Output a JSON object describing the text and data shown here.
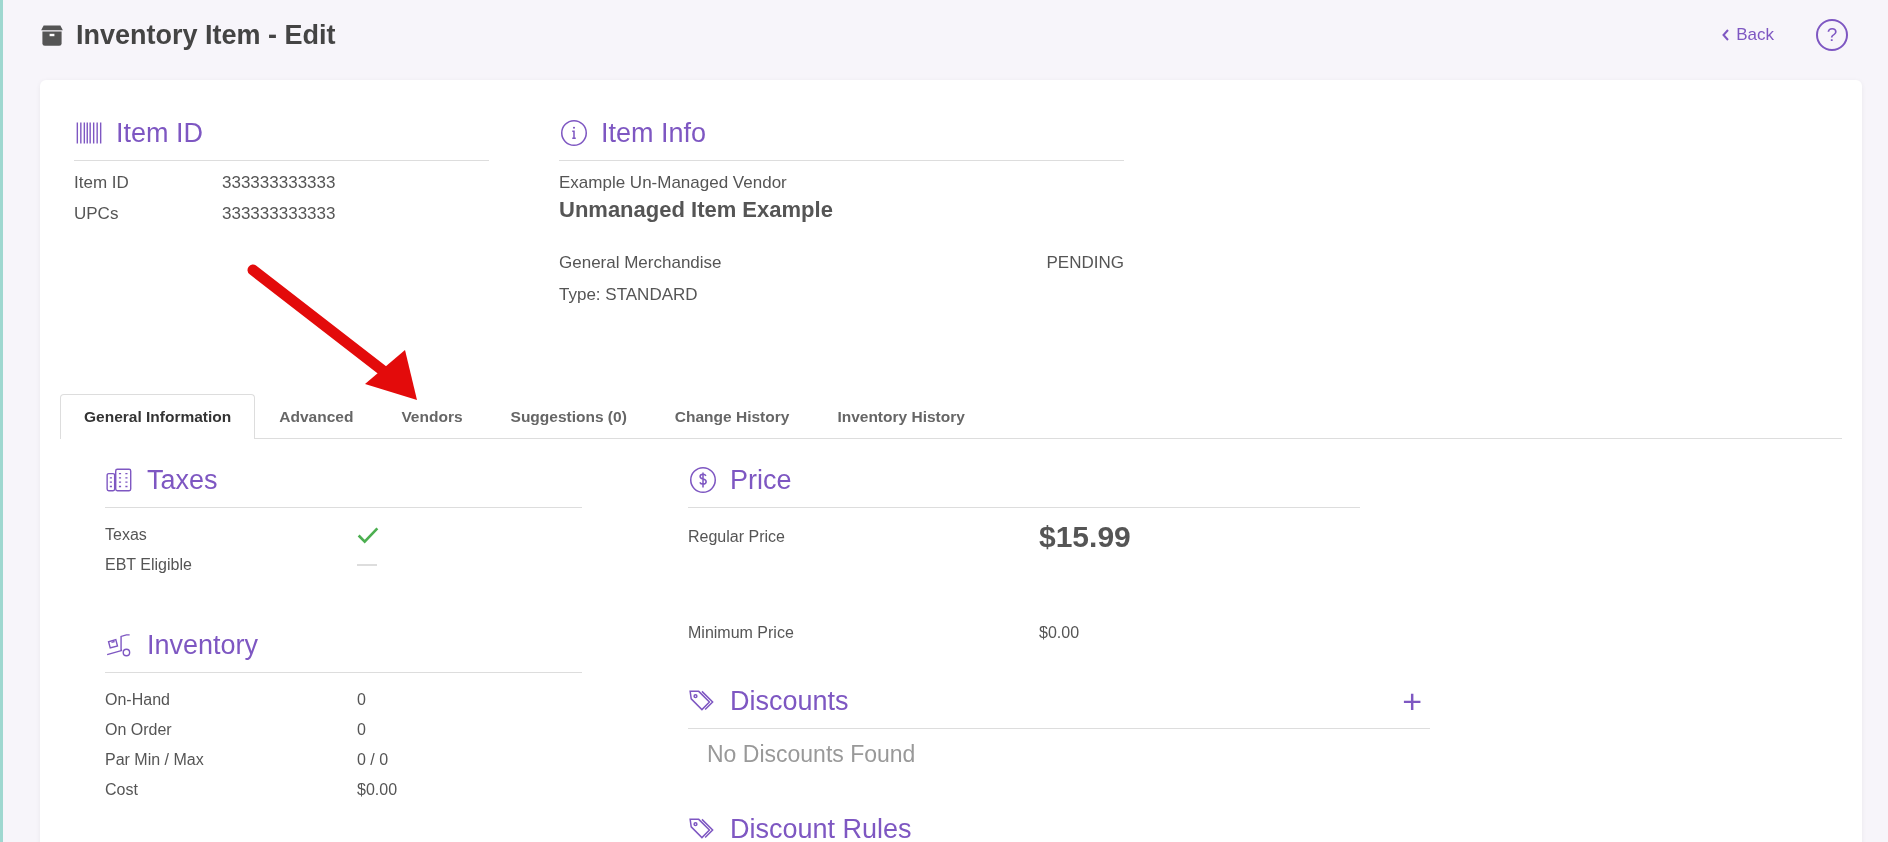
{
  "page": {
    "title": "Inventory Item - Edit",
    "back_link": "Back",
    "help_button": "?"
  },
  "item_id": {
    "heading": "Item ID",
    "rows": [
      {
        "label": "Item ID",
        "value": "333333333333"
      },
      {
        "label": "UPCs",
        "value": "333333333333"
      }
    ]
  },
  "item_info": {
    "heading": "Item Info",
    "vendor": "Example Un-Managed Vendor",
    "name": "Unmanaged Item Example",
    "category": "General Merchandise",
    "status": "PENDING",
    "type": "Type: STANDARD"
  },
  "tabs": [
    {
      "label": "General Information",
      "selected": true
    },
    {
      "label": "Advanced",
      "selected": false
    },
    {
      "label": "Vendors",
      "selected": false
    },
    {
      "label": "Suggestions (0)",
      "selected": false
    },
    {
      "label": "Change History",
      "selected": false
    },
    {
      "label": "Inventory History",
      "selected": false
    }
  ],
  "taxes": {
    "heading": "Taxes",
    "rows": [
      {
        "label": "Texas",
        "checked": true
      },
      {
        "label": "EBT Eligible",
        "checked": false
      }
    ]
  },
  "inventory": {
    "heading": "Inventory",
    "rows": [
      {
        "label": "On-Hand",
        "value": "0"
      },
      {
        "label": "On Order",
        "value": "0"
      },
      {
        "label": "Par Min / Max",
        "value": "0 / 0"
      },
      {
        "label": "Cost",
        "value": "$0.00"
      }
    ]
  },
  "price": {
    "heading": "Price",
    "regular_label": "Regular Price",
    "regular_value": "$15.99",
    "minimum_label": "Minimum Price",
    "minimum_value": "$0.00"
  },
  "discounts": {
    "heading": "Discounts",
    "add_button": "+",
    "empty_text": "No Discounts Found"
  },
  "discount_rules": {
    "heading": "Discount Rules"
  }
}
